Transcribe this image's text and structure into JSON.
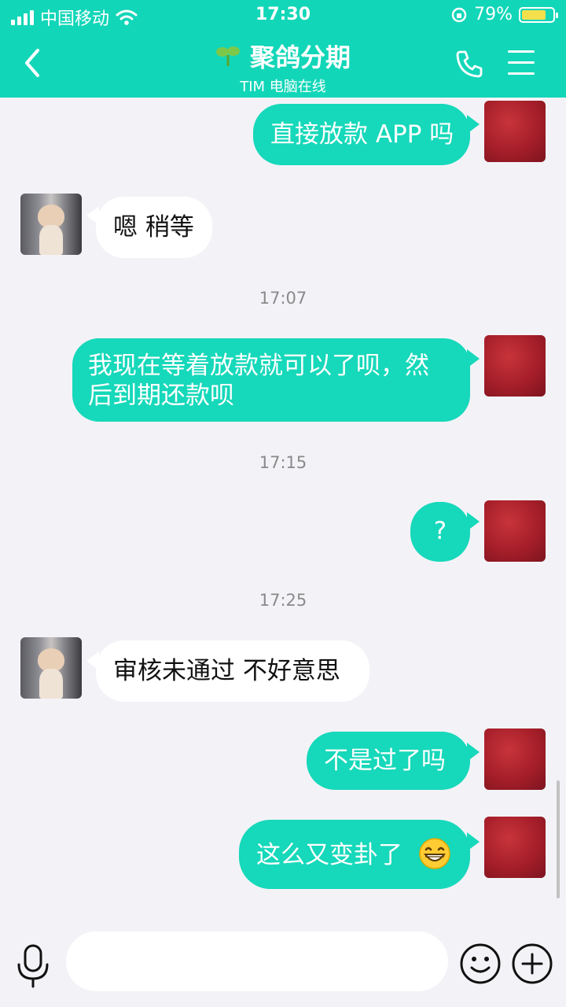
{
  "status_bar": {
    "carrier": "中国移动",
    "time": "17:30",
    "battery": "79%",
    "battery_level": 0.79
  },
  "header": {
    "title": "聚鸽分期",
    "subtitle": "TIM 电脑在线"
  },
  "messages": [
    {
      "text": "直接放款 APP 吗"
    },
    {
      "text": "嗯 稍等"
    },
    {
      "text": "我现在等着放款就可以了呗，然后到期还款呗"
    },
    {
      "text": "?"
    },
    {
      "text": "审核未通过 不好意思"
    },
    {
      "text": "不是过了吗"
    },
    {
      "text": "这么又变卦了"
    }
  ],
  "timestamps": [
    "17:07",
    "17:15",
    "17:25"
  ],
  "icons": {
    "back": "chevron-left-icon",
    "call": "phone-icon",
    "menu": "hamburger-menu-icon",
    "mic": "microphone-icon",
    "emoji": "smiley-icon",
    "plus": "plus-circle-icon",
    "grin": "grinning-face-emoji"
  },
  "colors": {
    "brand": "#12d6b8",
    "bubble_out": "#16d8ba",
    "bubble_in": "#ffffff",
    "background": "#f3f3f7"
  }
}
